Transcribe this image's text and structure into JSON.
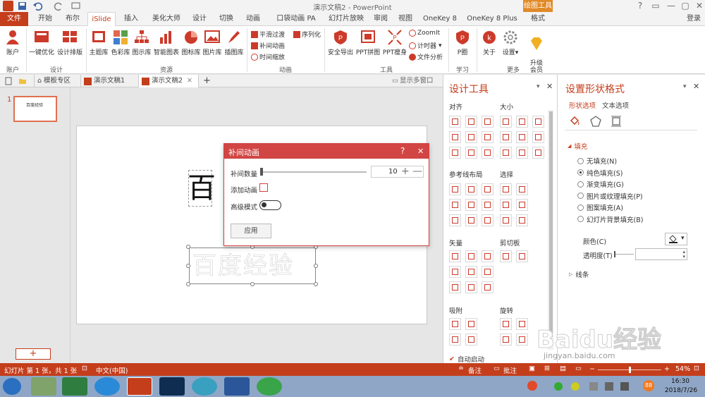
{
  "window": {
    "title": "演示文稿2 - PowerPoint",
    "contextual_title": "绘图工具",
    "controls": [
      "?",
      "▭",
      "—",
      "▢",
      "✕"
    ]
  },
  "tabs": [
    "文件",
    "开始",
    "布尔",
    "iSlide",
    "插入",
    "美化大师",
    "设计",
    "切换",
    "动画",
    "口袋动画 PA",
    "幻灯片放映",
    "审阅",
    "视图",
    "OneKey 8",
    "OneKey 8 Plus",
    "格式"
  ],
  "login_label": "登录",
  "ribbon": {
    "account": {
      "btn": "账户",
      "group": "账户"
    },
    "design": {
      "btns": [
        "一键优化",
        "设计排版"
      ],
      "group": "设计"
    },
    "resources": {
      "btns": [
        "主题库",
        "色彩库",
        "图示库",
        "智能图表",
        "图标库",
        "图片库",
        "插图库"
      ],
      "group": "资源"
    },
    "animation": {
      "items": [
        "平滑过渡",
        "序列化",
        "补间动画",
        "时间缩放"
      ],
      "group": "动画"
    },
    "tools": {
      "btns": [
        "安全导出",
        "PPT拼图",
        "PPT瘦身"
      ],
      "items": [
        "ZoomIt",
        "计时器",
        "文件分析"
      ],
      "group": "工具"
    },
    "learn": {
      "btn": "P圈",
      "group": "学习"
    },
    "more": {
      "btns": [
        "关于",
        "设置",
        "升级\n会员"
      ],
      "group": "更多"
    }
  },
  "doc_tabs": [
    "模板专区",
    "演示文稿1",
    "演示文稿2"
  ],
  "show_multi_window": "显示多窗口",
  "thumbnail": {
    "number": "1",
    "text": "百度经验"
  },
  "slide": {
    "big_char": "百",
    "outline_text": "百度经验"
  },
  "dialog": {
    "title": "补间动画",
    "help": "?",
    "close": "✕",
    "count_label": "补间数量",
    "count_value": "10",
    "add_anim_label": "添加动画",
    "advanced_label": "高级模式",
    "apply": "应用"
  },
  "design_tools": {
    "title": "设计工具",
    "sections": [
      "对齐",
      "大小",
      "参考线布局",
      "选择",
      "矢量",
      "剪切板",
      "吸附",
      "旋转"
    ],
    "auto_start": "自动启动"
  },
  "format_pane": {
    "title": "设置形状格式",
    "tabs": [
      "形状选项",
      "文本选项"
    ],
    "fill_header": "填充",
    "fill_options": [
      "无填充(N)",
      "纯色填充(S)",
      "渐变填充(G)",
      "图片或纹理填充(P)",
      "图案填充(A)",
      "幻灯片背景填充(B)"
    ],
    "selected": 1,
    "color_label": "颜色(C)",
    "transparency_label": "透明度(T)",
    "line_header": "线条"
  },
  "status": {
    "slide": "幻灯片 第 1 张，共 1 张",
    "lang": "中文(中国)",
    "notes": "备注",
    "comments": "批注",
    "zoom": "54%"
  },
  "taskbar": {
    "time": "16:30",
    "date": "2018/7/26",
    "badge": "88"
  },
  "watermark": {
    "text": "Baidu经验",
    "url": "jingyan.baidu.com"
  },
  "colors": {
    "accent": "#c43e1c",
    "dialog": "#d14644",
    "contextual": "#e08a28"
  }
}
